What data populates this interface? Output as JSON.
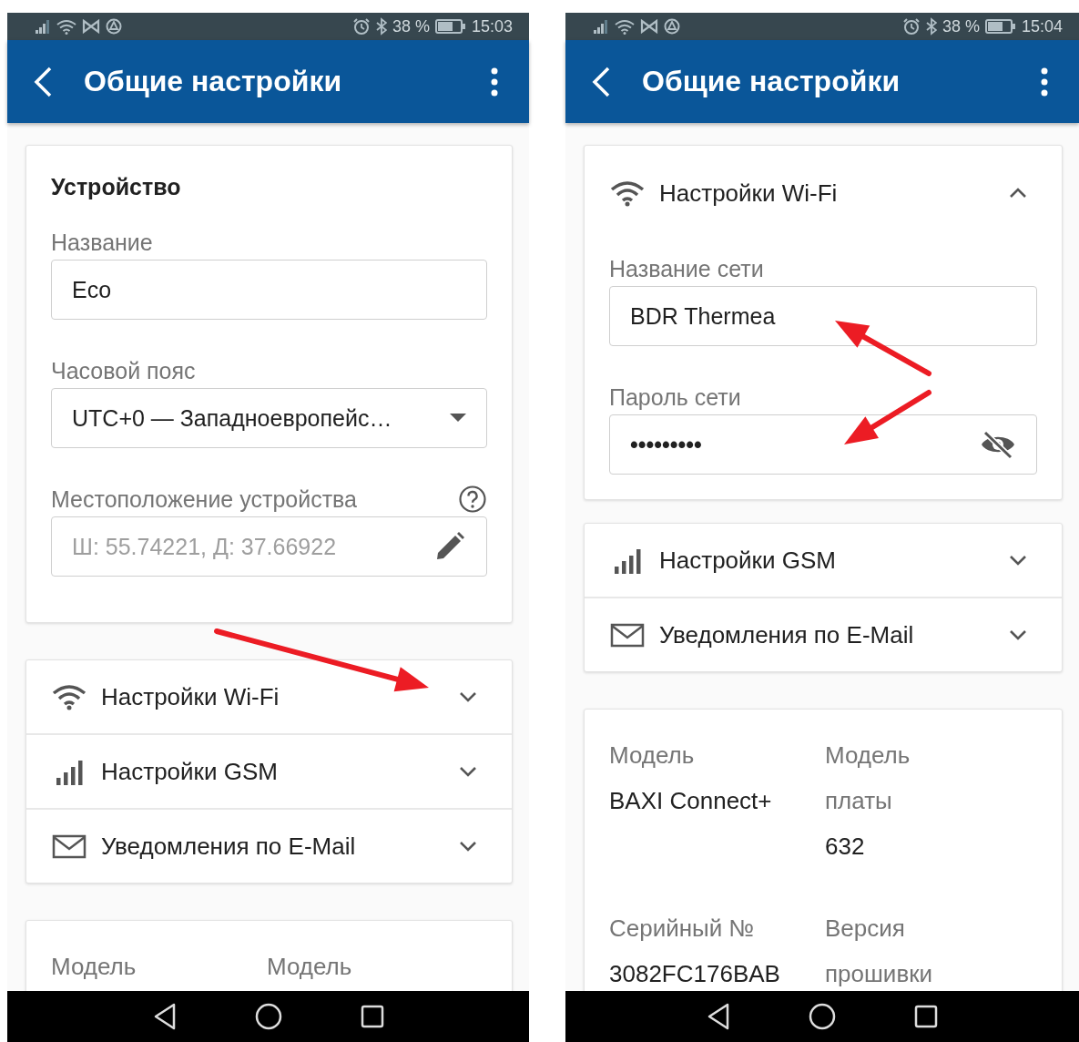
{
  "screens": [
    {
      "status_bar": {
        "battery": "38 %",
        "time": "15:03"
      },
      "app_bar": {
        "title": "Общие настройки"
      },
      "sections": [
        {
          "kind": "form",
          "title": "Устройство",
          "fields": [
            {
              "kind": "text",
              "label": "Название",
              "value": "Eco"
            },
            {
              "kind": "select",
              "label": "Часовой пояс",
              "value": "UTC+0 — Западноевропейс…"
            },
            {
              "kind": "location",
              "label": "Местоположение устройства",
              "value": "Ш: 55.74221, Д: 37.66922",
              "disabled": true
            }
          ]
        },
        {
          "kind": "accordion",
          "items": [
            {
              "kind": "wifi",
              "label": "Настройки Wi-Fi",
              "expanded": false,
              "arrow": true
            },
            {
              "kind": "gsm",
              "label": "Настройки GSM",
              "expanded": false
            },
            {
              "kind": "email",
              "label": "Уведомления по E-Mail",
              "expanded": false
            }
          ]
        },
        {
          "kind": "info",
          "pairs": [
            {
              "label": "Модель"
            },
            {
              "label": "Модель"
            }
          ]
        }
      ]
    },
    {
      "status_bar": {
        "battery": "38 %",
        "time": "15:04"
      },
      "app_bar": {
        "title": "Общие настройки"
      },
      "sections": [
        {
          "kind": "accordion",
          "items": [
            {
              "kind": "wifi",
              "label": "Настройки Wi-Fi",
              "expanded": true,
              "fields": [
                {
                  "kind": "text",
                  "label": "Название сети",
                  "value": "BDR Thermea",
                  "arrow": true
                },
                {
                  "kind": "password",
                  "label": "Пароль сети",
                  "value": "•••••••••",
                  "arrow": true
                }
              ]
            }
          ]
        },
        {
          "kind": "accordion",
          "items": [
            {
              "kind": "gsm",
              "label": "Настройки GSM",
              "expanded": false
            },
            {
              "kind": "email",
              "label": "Уведомления по E-Mail",
              "expanded": false
            }
          ]
        },
        {
          "kind": "info",
          "pairs": [
            {
              "label": "Модель",
              "value": "BAXI Connect+"
            },
            {
              "label": "Модель платы",
              "value": "632"
            },
            {
              "label": "Серийный №",
              "value": "3082FC176BAB"
            },
            {
              "label": "Версия прошивки"
            }
          ]
        }
      ]
    }
  ]
}
